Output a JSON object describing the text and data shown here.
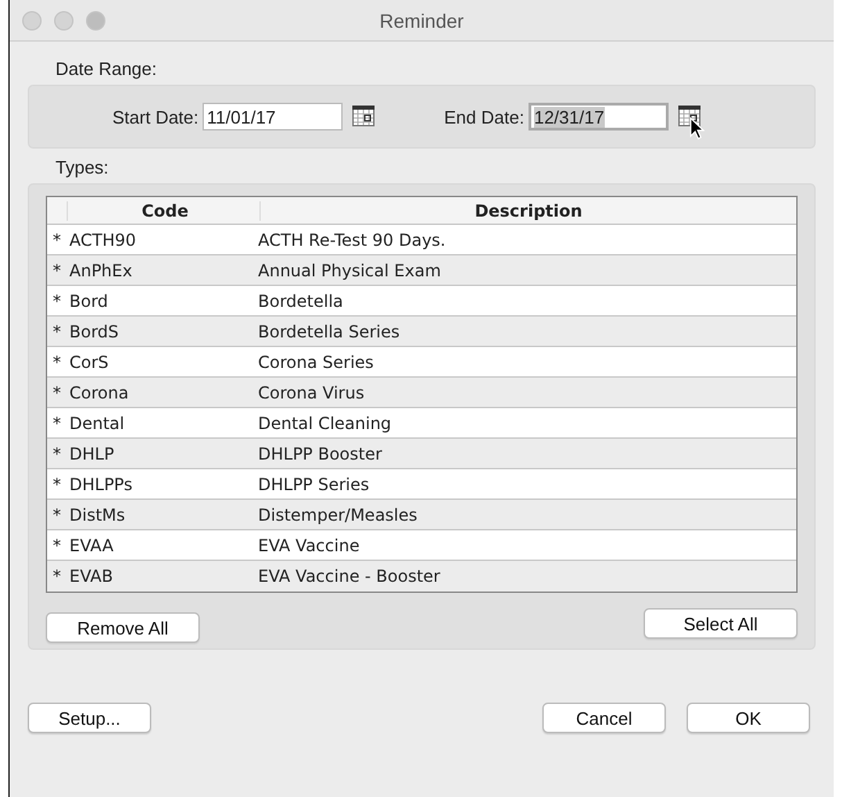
{
  "window": {
    "title": "Reminder"
  },
  "date_range": {
    "label": "Date Range:",
    "fields": [
      {
        "label": "Start Date:",
        "value": "11/01/17",
        "text_selected": false
      },
      {
        "label": "End Date:",
        "value": "12/31/17",
        "text_selected": true
      }
    ]
  },
  "types": {
    "label": "Types:",
    "columns": [
      "Code",
      "Description"
    ],
    "rows": [
      {
        "marker": "*",
        "code": "ACTH90",
        "description": "ACTH Re-Test 90 Days."
      },
      {
        "marker": "*",
        "code": "AnPhEx",
        "description": "Annual Physical Exam"
      },
      {
        "marker": "*",
        "code": "Bord",
        "description": "Bordetella"
      },
      {
        "marker": "*",
        "code": "BordS",
        "description": "Bordetella Series"
      },
      {
        "marker": "*",
        "code": "CorS",
        "description": "Corona Series"
      },
      {
        "marker": "*",
        "code": "Corona",
        "description": "Corona Virus"
      },
      {
        "marker": "*",
        "code": "Dental",
        "description": "Dental Cleaning"
      },
      {
        "marker": "*",
        "code": "DHLP",
        "description": "DHLPP Booster"
      },
      {
        "marker": "*",
        "code": "DHLPPs",
        "description": "DHLPP Series"
      },
      {
        "marker": "*",
        "code": "DistMs",
        "description": "Distemper/Measles"
      },
      {
        "marker": "*",
        "code": "EVAA",
        "description": "EVA Vaccine"
      },
      {
        "marker": "*",
        "code": "EVAB",
        "description": "EVA Vaccine - Booster"
      }
    ],
    "buttons": [
      "Remove All",
      "Select All"
    ]
  },
  "footer_buttons": [
    "Setup...",
    "Cancel",
    "OK"
  ]
}
